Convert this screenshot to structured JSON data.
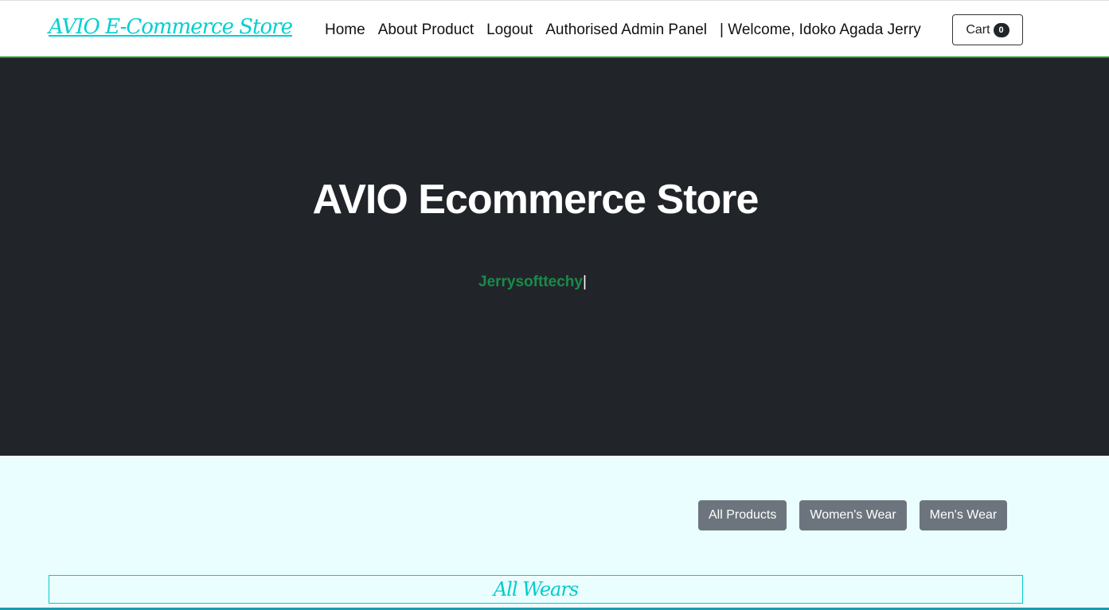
{
  "nav": {
    "brand": "AVIO E-Commerce Store",
    "links": [
      "Home",
      "About Product",
      "Logout",
      "Authorised Admin Panel",
      "| Welcome, Idoko Agada Jerry"
    ],
    "cart_label": "Cart",
    "cart_count": "0"
  },
  "hero": {
    "title": "AVIO Ecommerce Store",
    "typed": "Jerrysofttechy",
    "caret": "|"
  },
  "filters": [
    "All Products",
    "Women's Wear",
    "Men's Wear"
  ],
  "section": {
    "title": "All Wears"
  },
  "colors": {
    "brand": "#00d0d0",
    "hero_bg": "#212529",
    "typed": "#1a8a4a",
    "filter_btn": "#6c757d"
  }
}
